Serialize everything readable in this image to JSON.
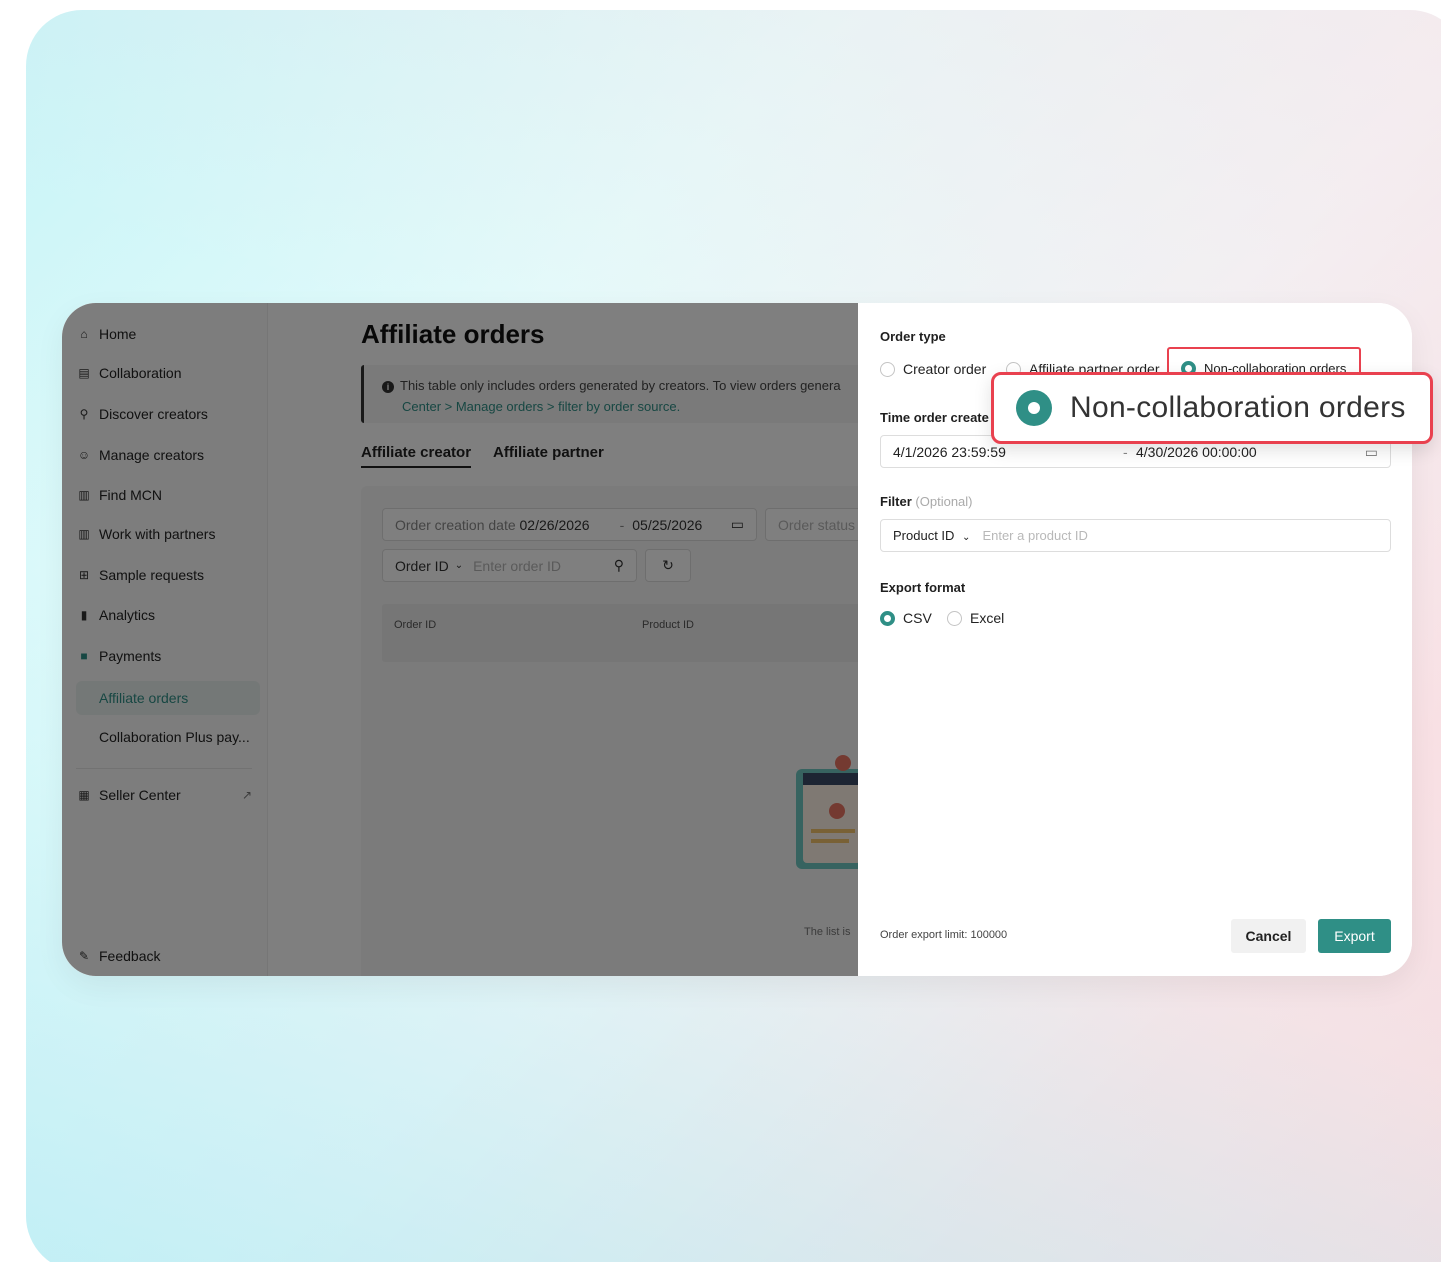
{
  "sidebar": {
    "items": [
      {
        "label": "Home",
        "icon": "home-icon"
      },
      {
        "label": "Collaboration",
        "icon": "clipboard-icon"
      },
      {
        "label": "Discover creators",
        "icon": "user-search-icon"
      },
      {
        "label": "Manage creators",
        "icon": "users-icon"
      },
      {
        "label": "Find MCN",
        "icon": "building-icon"
      },
      {
        "label": "Work with partners",
        "icon": "building-icon"
      },
      {
        "label": "Sample requests",
        "icon": "gift-icon"
      },
      {
        "label": "Analytics",
        "icon": "bar-chart-icon"
      },
      {
        "label": "Payments",
        "icon": "wallet-icon"
      }
    ],
    "sub_items": [
      "Affiliate orders",
      "Collaboration Plus pay..."
    ],
    "seller_center": "Seller Center",
    "feedback": "Feedback"
  },
  "main": {
    "title": "Affiliate orders",
    "info_line1": "This table only includes orders generated by creators. To view orders genera",
    "info_line2": "Center > Manage orders > filter by order source.",
    "tabs": [
      "Affiliate creator",
      "Affiliate partner"
    ],
    "date_label": "Order creation date",
    "date_start": "02/26/2026",
    "date_sep": "-",
    "date_end": "05/25/2026",
    "status_placeholder": "Order status",
    "order_id_select": "Order ID",
    "order_id_placeholder": "Enter order ID",
    "columns": [
      "Order ID",
      "Product ID"
    ],
    "list_note": "The list is"
  },
  "drawer": {
    "order_type_label": "Order type",
    "order_types": [
      "Creator order",
      "Affiliate partner order",
      "Non-collaboration orders"
    ],
    "selected_order_type": "Non-collaboration orders",
    "time_label": "Time order create",
    "time_start": "4/1/2026 23:59:59",
    "time_sep": "-",
    "time_end": "4/30/2026 00:00:00",
    "filter_label": "Filter",
    "filter_optional": "(Optional)",
    "filter_select": "Product ID",
    "filter_placeholder": "Enter a product ID",
    "export_format_label": "Export format",
    "formats": [
      "CSV",
      "Excel"
    ],
    "selected_format": "CSV",
    "limit_text": "Order export limit: 100000",
    "cancel_label": "Cancel",
    "export_label": "Export"
  },
  "callout": {
    "text": "Non-collaboration orders"
  },
  "colors": {
    "accent": "#2f8f86",
    "highlight": "#e9414f"
  }
}
